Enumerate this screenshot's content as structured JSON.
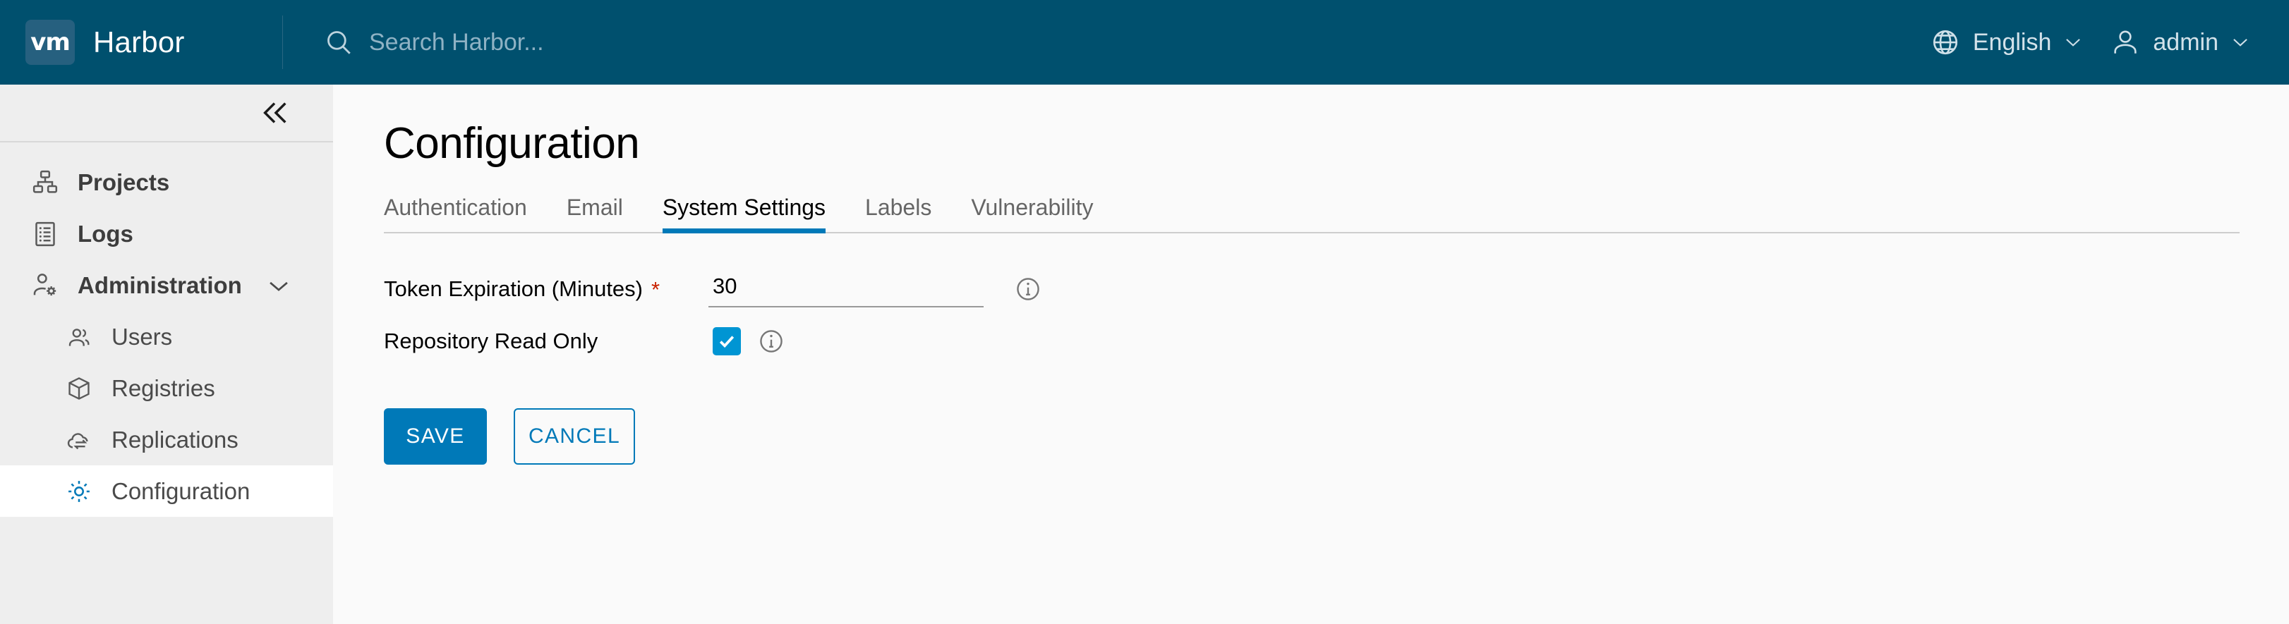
{
  "header": {
    "logo_text": "vm",
    "logo_icon": "vmware-logo-icon",
    "title": "Harbor",
    "search": {
      "icon": "search-icon",
      "placeholder": "Search Harbor...",
      "value": ""
    },
    "language": {
      "icon": "globe-icon",
      "label": "English",
      "caret": "chevron-down-icon"
    },
    "account": {
      "icon": "user-icon",
      "label": "admin",
      "caret": "chevron-down-icon"
    }
  },
  "sidebar": {
    "collapse_icon": "double-chevron-left-icon",
    "items": [
      {
        "label": "Projects",
        "icon": "projects-icon",
        "level": "top",
        "active": false,
        "bold": true,
        "expandable": false
      },
      {
        "label": "Logs",
        "icon": "logs-icon",
        "level": "top",
        "active": false,
        "bold": true,
        "expandable": false
      },
      {
        "label": "Administration",
        "icon": "administration-icon",
        "level": "top",
        "active": false,
        "bold": true,
        "expandable": true
      },
      {
        "label": "Users",
        "icon": "users-icon",
        "level": "sub",
        "active": false,
        "bold": false,
        "expandable": false
      },
      {
        "label": "Registries",
        "icon": "registries-icon",
        "level": "sub",
        "active": false,
        "bold": false,
        "expandable": false
      },
      {
        "label": "Replications",
        "icon": "replications-icon",
        "level": "sub",
        "active": false,
        "bold": false,
        "expandable": false
      },
      {
        "label": "Configuration",
        "icon": "configuration-icon",
        "level": "sub",
        "active": true,
        "bold": false,
        "expandable": false
      }
    ]
  },
  "main": {
    "page_title": "Configuration",
    "tabs": [
      {
        "label": "Authentication",
        "active": false
      },
      {
        "label": "Email",
        "active": false
      },
      {
        "label": "System Settings",
        "active": true
      },
      {
        "label": "Labels",
        "active": false
      },
      {
        "label": "Vulnerability",
        "active": false
      }
    ],
    "form": {
      "token_expiration": {
        "label": "Token Expiration (Minutes)",
        "required_marker": "*",
        "value": "30",
        "placeholder": "",
        "info_icon": "info-circle-icon"
      },
      "repository_read_only": {
        "label": "Repository Read Only",
        "checked": true,
        "check_icon": "checkmark-icon",
        "info_icon": "info-circle-icon"
      }
    },
    "buttons": {
      "save": "SAVE",
      "cancel": "CANCEL"
    }
  },
  "colors": {
    "header_bg": "#00506e",
    "accent": "#0079b8",
    "checkbox": "#0095d3",
    "required": "#c92100",
    "sidebar_bg": "#eeeeee",
    "main_bg": "#fafafa"
  }
}
